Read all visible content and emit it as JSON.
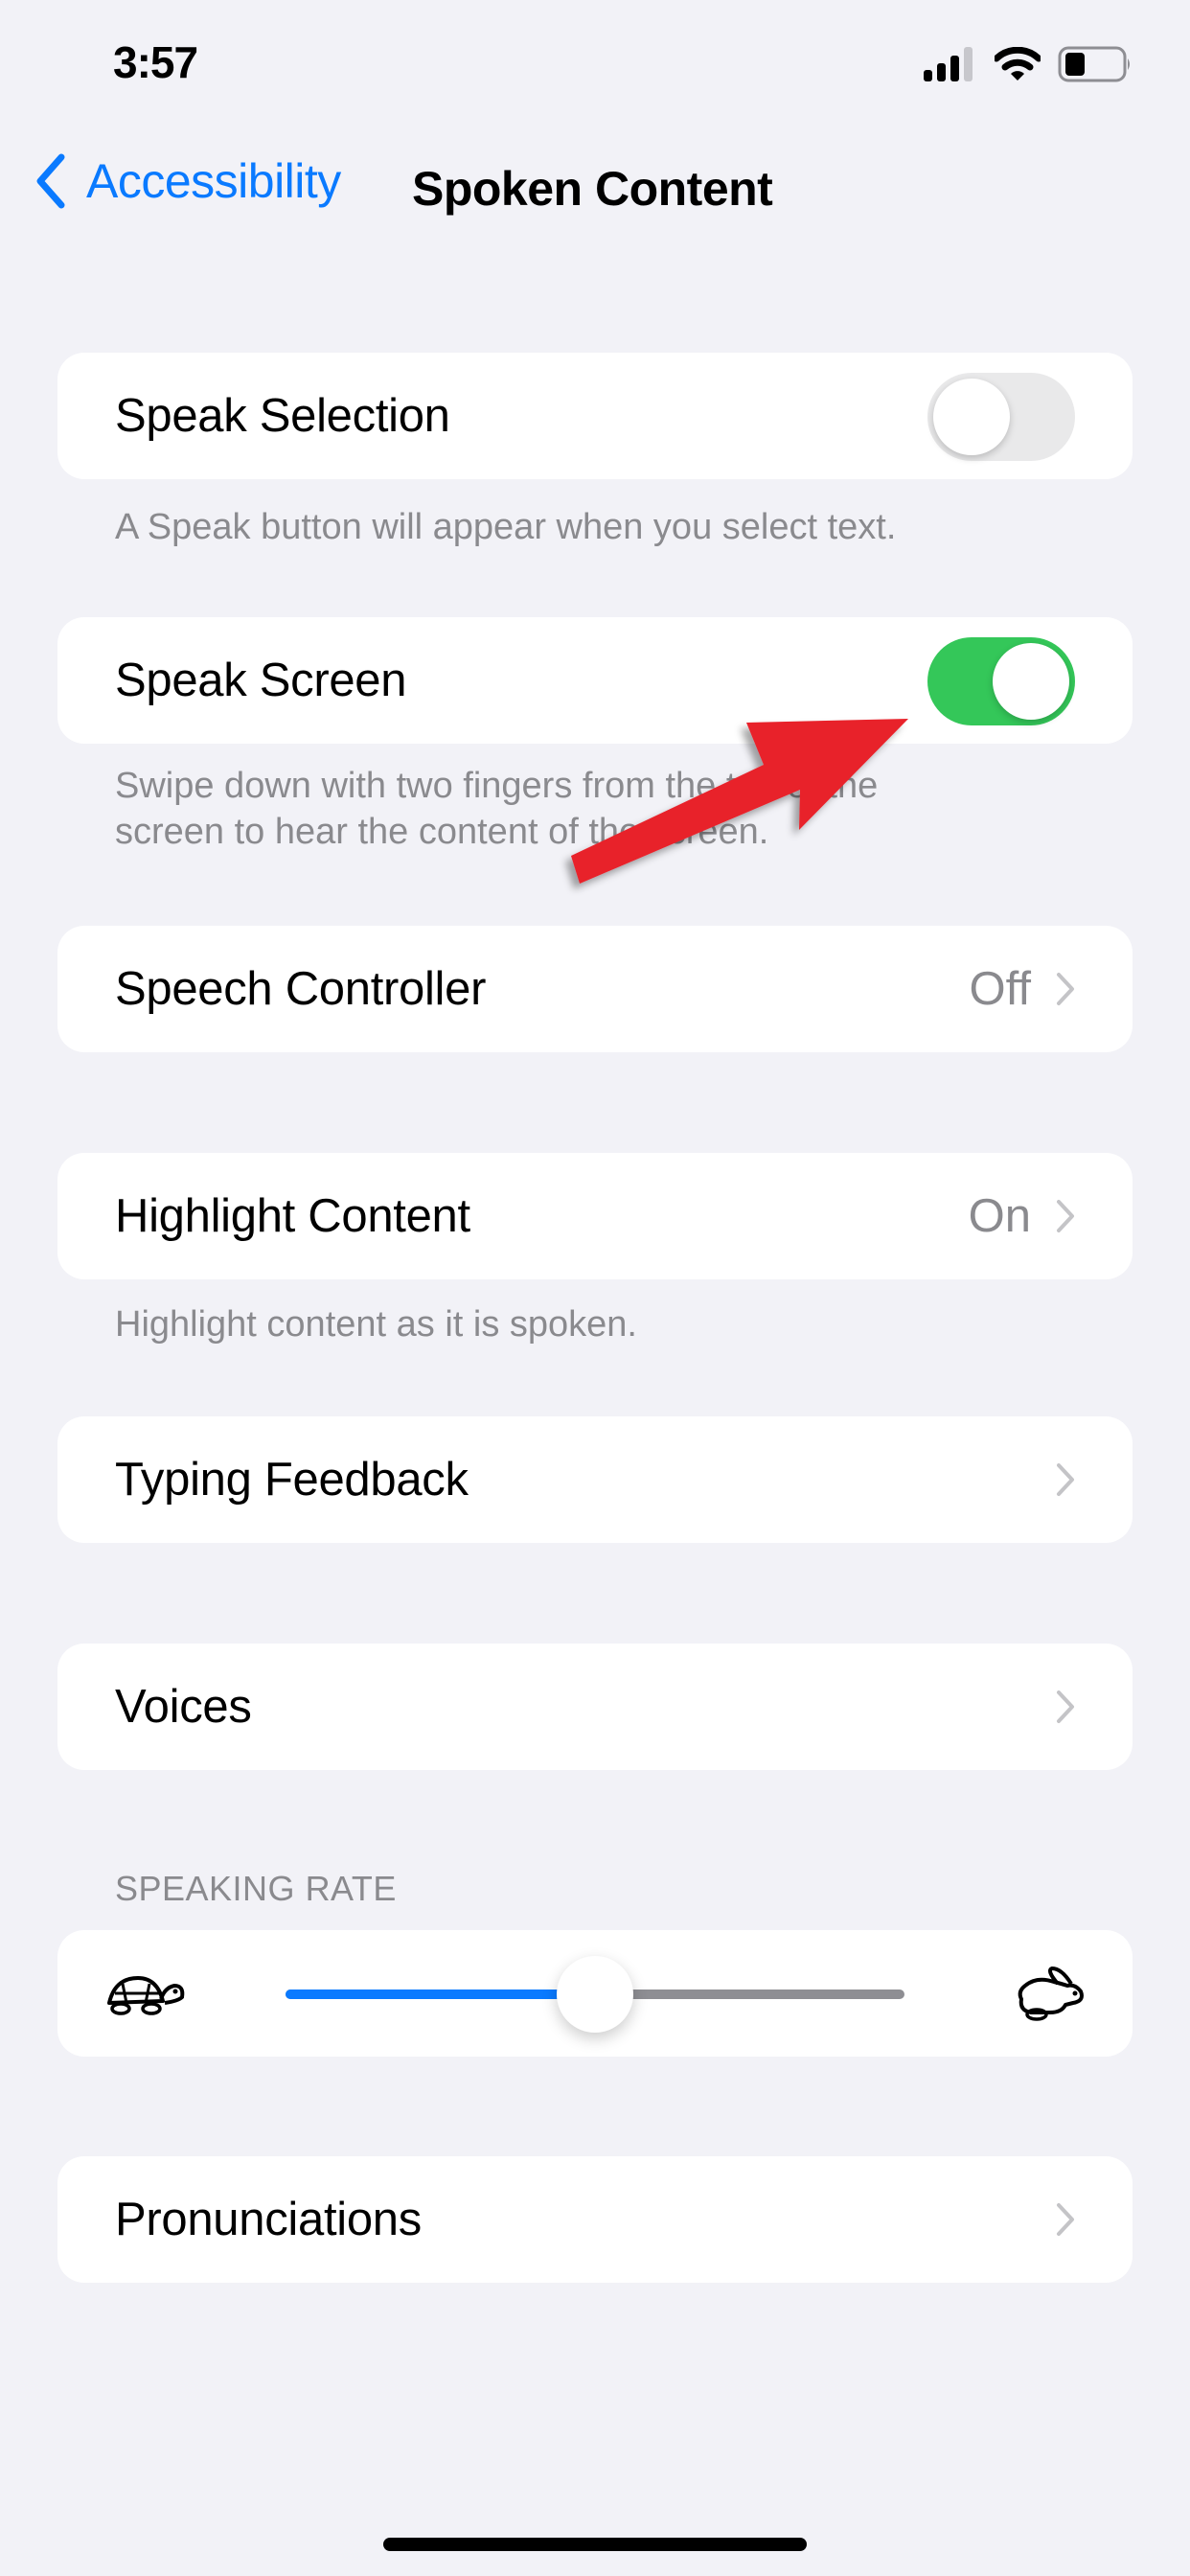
{
  "status_bar": {
    "time": "3:57",
    "icons": [
      "cellular-signal-icon",
      "wifi-icon",
      "battery-icon"
    ],
    "signal_bars_active": 3,
    "signal_bars_total": 4,
    "battery_level": 0.3
  },
  "nav": {
    "back_label": "Accessibility",
    "title": "Spoken Content",
    "accent_color": "#0a7aff"
  },
  "settings": {
    "speak_selection": {
      "label": "Speak Selection",
      "enabled": false,
      "footer": "A Speak button will appear when you select text."
    },
    "speak_screen": {
      "label": "Speak Screen",
      "enabled": true,
      "footer": "Swipe down with two fingers from the top of the screen to hear the content of the screen."
    },
    "speech_controller": {
      "label": "Speech Controller",
      "value": "Off"
    },
    "highlight_content": {
      "label": "Highlight Content",
      "value": "On",
      "footer": "Highlight content as it is spoken."
    },
    "typing_feedback": {
      "label": "Typing Feedback"
    },
    "voices": {
      "label": "Voices"
    },
    "speaking_rate": {
      "header": "SPEAKING RATE",
      "value": 0.5,
      "min_icon": "turtle-icon",
      "max_icon": "rabbit-icon"
    },
    "pronunciations": {
      "label": "Pronunciations"
    }
  },
  "colors": {
    "toggle_on": "#34c759",
    "toggle_off": "#e9e9ea",
    "slider_fill": "#0a7aff",
    "slider_track": "#8e8e93",
    "annotation_arrow": "#e8202a"
  },
  "annotation": {
    "type": "arrow",
    "points_to": "speak-screen-toggle"
  }
}
